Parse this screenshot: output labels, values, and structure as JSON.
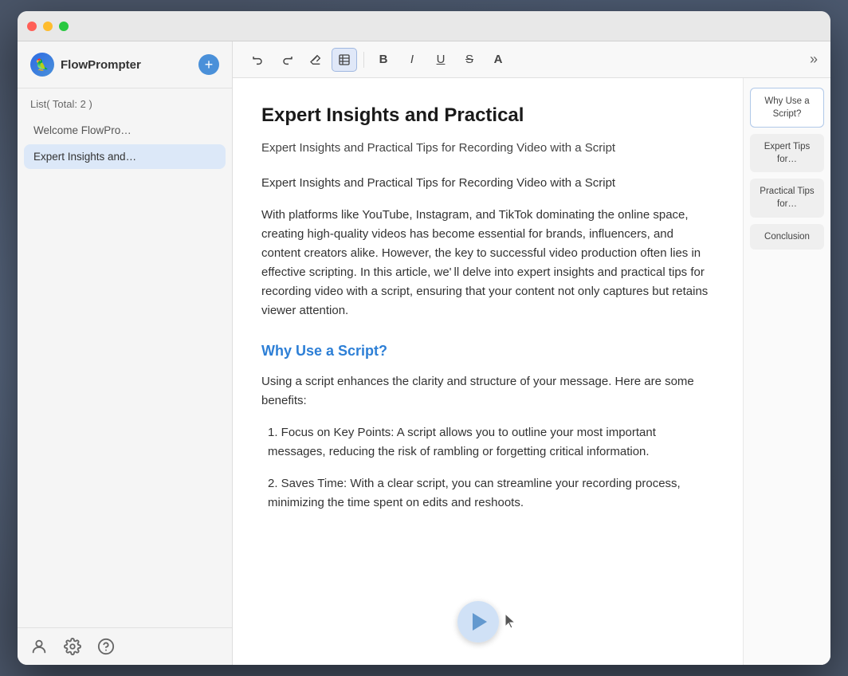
{
  "app": {
    "name": "FlowPrompter",
    "logo_symbol": "🦜"
  },
  "sidebar": {
    "list_label": "List( Total: 2 )",
    "add_button_label": "+",
    "items": [
      {
        "id": "welcome",
        "label": "Welcome FlowPro…",
        "active": false
      },
      {
        "id": "expert-insights",
        "label": "Expert Insights and…",
        "active": true
      }
    ],
    "footer_icons": [
      "user-icon",
      "gear-icon",
      "help-icon"
    ]
  },
  "toolbar": {
    "buttons": [
      {
        "id": "undo",
        "symbol": "↩",
        "label": "Undo",
        "active": false
      },
      {
        "id": "redo",
        "symbol": "↪",
        "label": "Redo",
        "active": false
      },
      {
        "id": "eraser",
        "symbol": "◈",
        "label": "Eraser",
        "active": false
      },
      {
        "id": "table",
        "symbol": "⊞",
        "label": "Table",
        "active": true
      },
      {
        "id": "bold",
        "symbol": "B",
        "label": "Bold",
        "active": false
      },
      {
        "id": "italic",
        "symbol": "I",
        "label": "Italic",
        "active": false
      },
      {
        "id": "underline",
        "symbol": "U",
        "label": "Underline",
        "active": false
      },
      {
        "id": "strikethrough",
        "symbol": "S",
        "label": "Strikethrough",
        "active": false
      },
      {
        "id": "font",
        "symbol": "A",
        "label": "Font",
        "active": false
      }
    ],
    "more_label": "»"
  },
  "document": {
    "title": "Expert Insights and Practical",
    "subtitle": "Expert Insights and Practical Tips for Recording Video with a Script",
    "intro": " Expert Insights and Practical Tips for Recording Video with a Script",
    "body_para1": "With platforms like YouTube, Instagram, and TikTok dominating the online space, creating high-quality videos has become essential for brands, influencers, and content creators alike. However, the key to successful video production often lies in effective scripting. In this article, we' ll delve into expert insights and practical tips for recording video with a script, ensuring that your content not only captures but retains viewer attention.",
    "section1_heading": "Why Use a Script?",
    "section1_intro": " Using a script enhances the clarity and structure of your message. Here are some benefits:",
    "section1_item1": " 1. Focus on Key Points: A script allows you to outline your most important messages, reducing the risk of rambling or forgetting critical information.",
    "section1_item2": " 2. Saves Time: With a clear script, you can streamline your recording process, minimizing the time spent on edits and reshoots."
  },
  "outline": {
    "items": [
      {
        "id": "why-use",
        "label": "Why Use a Script?",
        "active": true
      },
      {
        "id": "expert-tips",
        "label": "Expert Tips for…",
        "active": false
      },
      {
        "id": "practical-tips",
        "label": "Practical Tips for…",
        "active": false
      },
      {
        "id": "conclusion",
        "label": "Conclusion",
        "active": false
      }
    ]
  },
  "colors": {
    "accent": "#2d7fd6",
    "active_outline": "#b0c8e8",
    "sidebar_active": "#dce8f8"
  }
}
